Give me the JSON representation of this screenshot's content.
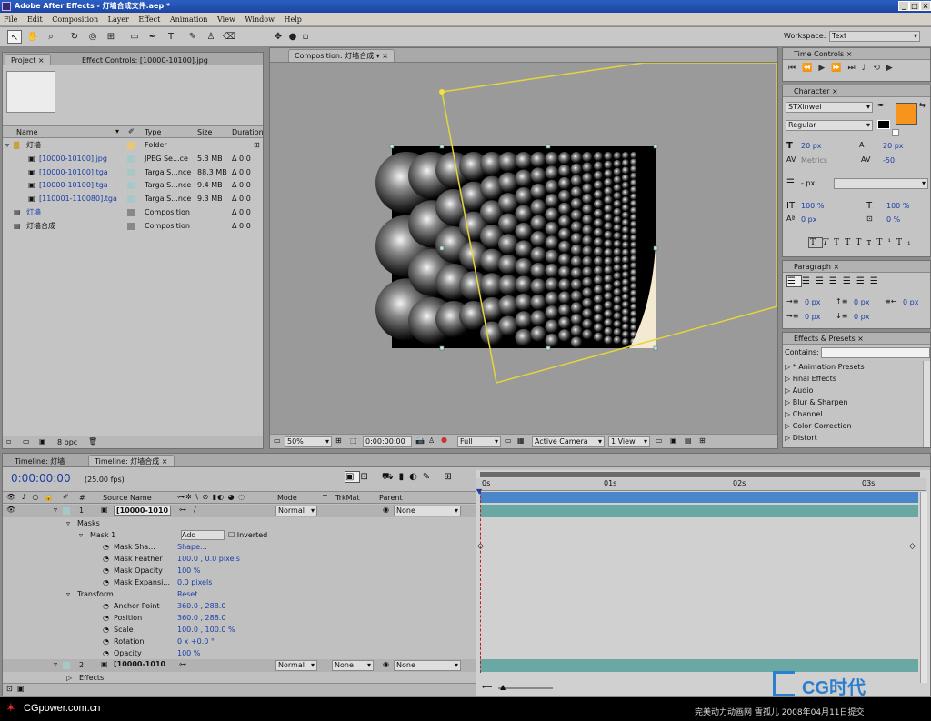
{
  "window": {
    "title": "Adobe After Effects - 灯墙合成文件.aep *"
  },
  "menu": [
    "File",
    "Edit",
    "Composition",
    "Layer",
    "Effect",
    "Animation",
    "View",
    "Window",
    "Help"
  ],
  "toolbar": {
    "workspace_label": "Workspace:",
    "workspace_value": "Text"
  },
  "project": {
    "tab_project": "Project",
    "tab_effect_controls": "Effect Controls: [10000-10100].jpg",
    "columns": [
      "Name",
      "Type",
      "Size",
      "Duration"
    ],
    "items": [
      {
        "name": "灯墙",
        "type": "Folder",
        "size": "",
        "duration": ""
      },
      {
        "name": "[10000-10100].jpg",
        "type": "JPEG Se...ce",
        "size": "5.3 MB",
        "duration": "Δ 0:0"
      },
      {
        "name": "[10000-10100].tga",
        "type": "Targa S...nce",
        "size": "88.3 MB",
        "duration": "Δ 0:0"
      },
      {
        "name": "[10000-10100].tga",
        "type": "Targa S...nce",
        "size": "9.4 MB",
        "duration": "Δ 0:0"
      },
      {
        "name": "[110001-110080].tga",
        "type": "Targa S...nce",
        "size": "9.3 MB",
        "duration": "Δ 0:0"
      },
      {
        "name": "灯墙",
        "type": "Composition",
        "size": "",
        "duration": "Δ 0:0"
      },
      {
        "name": "灯墙合成",
        "type": "Composition",
        "size": "",
        "duration": "Δ 0:0"
      }
    ],
    "bpc": "8 bpc"
  },
  "composition": {
    "tab": "Composition: 灯墙合成",
    "zoom": "50%",
    "timecode": "0:00:00:00",
    "resolution": "Full",
    "camera": "Active Camera",
    "view": "1 View"
  },
  "time_controls": {
    "title": "Time Controls"
  },
  "character": {
    "title": "Character",
    "font": "STXinwei",
    "style": "Regular",
    "fill_color": "#f7941d",
    "size": "20 px",
    "leading": "20 px",
    "kerning": "Metrics",
    "tracking": "-50",
    "stroke": "- px",
    "vscale": "100 %",
    "hscale": "100 %",
    "baseline": "0 px",
    "tsume": "0 %"
  },
  "paragraph": {
    "title": "Paragraph",
    "indent_left": "0 px",
    "space_before": "0 px",
    "indent_right": "0 px",
    "indent_first": "0 px",
    "space_after": "0 px"
  },
  "effects_presets": {
    "title": "Effects & Presets",
    "contains_label": "Contains:",
    "items": [
      "* Animation Presets",
      "Final Effects",
      "Audio",
      "Blur & Sharpen",
      "Channel",
      "Color Correction",
      "Distort"
    ]
  },
  "timeline": {
    "tab1": "Timeline: 灯墙",
    "tab2": "Timeline: 灯墙合成",
    "timecode": "0:00:00:00",
    "fps": "(25.00 fps)",
    "columns": {
      "num": "#",
      "source": "Source Name",
      "mode": "Mode",
      "t": "T",
      "trkmat": "TrkMat",
      "parent": "Parent"
    },
    "ruler": [
      "0s",
      "01s",
      "02s",
      "03s"
    ],
    "layers": [
      {
        "num": "1",
        "name": "[10000-1010",
        "mode": "Normal",
        "trkmat": "",
        "parent": "None"
      },
      {
        "num": "2",
        "name": "[10000-1010",
        "mode": "Normal",
        "trkmat": "None",
        "parent": "None"
      }
    ],
    "props": [
      {
        "label": "Masks",
        "value": "",
        "indent": 1
      },
      {
        "label": "Mask 1",
        "value": "Add",
        "extra": "Inverted",
        "indent": 2
      },
      {
        "label": "Mask Sha...",
        "value": "Shape...",
        "indent": 3
      },
      {
        "label": "Mask Feather",
        "value": "100.0 , 0.0 pixels",
        "indent": 3
      },
      {
        "label": "Mask Opacity",
        "value": "100 %",
        "indent": 3
      },
      {
        "label": "Mask Expansi...",
        "value": "0.0 pixels",
        "indent": 3
      },
      {
        "label": "Transform",
        "value": "Reset",
        "indent": 1
      },
      {
        "label": "Anchor Point",
        "value": "360.0 , 288.0",
        "indent": 3
      },
      {
        "label": "Position",
        "value": "360.0 , 288.0",
        "indent": 3
      },
      {
        "label": "Scale",
        "value": "100.0 , 100.0 %",
        "indent": 3
      },
      {
        "label": "Rotation",
        "value": "0 x +0.0 °",
        "indent": 3
      },
      {
        "label": "Opacity",
        "value": "100 %",
        "indent": 3
      }
    ],
    "effects_label": "Effects"
  },
  "watermark": {
    "left": "CGpower.com.cn",
    "right": "完美动力动画网 雪孤儿 2008年04月11日提交",
    "logo": "CG时代"
  }
}
